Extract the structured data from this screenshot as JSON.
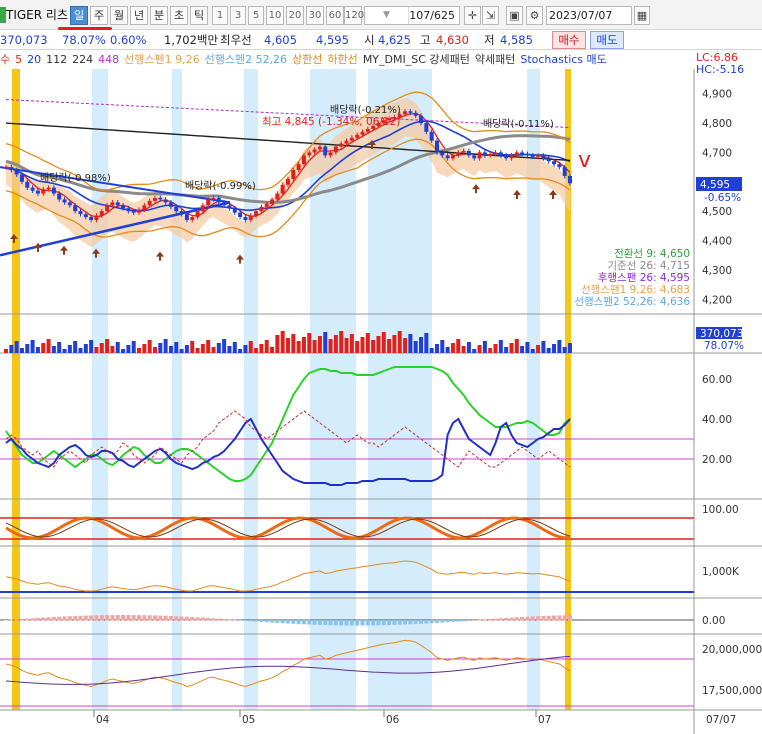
{
  "toolbar": {
    "ticker": "TIGER 리츠",
    "periods": [
      "일",
      "주",
      "월",
      "년",
      "분",
      "초",
      "틱"
    ],
    "active_period": "일",
    "intervals": [
      "1",
      "3",
      "5",
      "10",
      "20",
      "30",
      "60",
      "120"
    ],
    "count": "107/625",
    "date": "2023/07/07"
  },
  "quote": {
    "volume_lead": "370,073",
    "volume_ratio": "78.07%",
    "change_rate": "0.60%",
    "trade_value": "1,702백만",
    "best_label": "최우선",
    "best_ask": "4,605",
    "best_bid": "4,595",
    "open_label": "시",
    "open": "4,625",
    "high_label": "고",
    "high": "4,630",
    "low_label": "저",
    "low": "4,585",
    "buy_label": "매수",
    "sell_label": "매도"
  },
  "legend": {
    "items": [
      {
        "text": "수",
        "color": "#e0211b"
      },
      {
        "text": "5",
        "color": "#e0211b"
      },
      {
        "text": "20",
        "color": "#1f3fd6"
      },
      {
        "text": "112",
        "color": "#333333"
      },
      {
        "text": "224",
        "color": "#333333"
      },
      {
        "text": "448",
        "color": "#b030c0"
      },
      {
        "text": "선행스펜1 9,26",
        "color": "#e5a24a"
      },
      {
        "text": "선행스펜2 52,26",
        "color": "#5aa7e6"
      },
      {
        "text": "상한선",
        "color": "#e58a1a"
      },
      {
        "text": "하한선",
        "color": "#e58a1a"
      },
      {
        "text": "MY_DMI_SC 강세패턴",
        "color": "#333333"
      },
      {
        "text": "약세패턴",
        "color": "#333333"
      },
      {
        "text": "Stochastics 매도",
        "color": "#1f3fd6"
      }
    ],
    "lc": "LC:6.86",
    "hc": "HC:-5.16"
  },
  "price_axis": {
    "ticks": [
      "4,900",
      "4,800",
      "4,700",
      "4,600",
      "4,500",
      "4,400",
      "4,300",
      "4,200"
    ],
    "last_price": "4,595",
    "last_change": "-0.65%"
  },
  "ichimoku_info": [
    {
      "text": "전환선 9: 4,650",
      "color": "#2e9e3e"
    },
    {
      "text": "기준선 26: 4,715",
      "color": "#888888"
    },
    {
      "text": "후행스팬 26: 4,595",
      "color": "#8a2be2"
    },
    {
      "text": "선행스팬1 9,26: 4,683",
      "color": "#e5a24a"
    },
    {
      "text": "선행스팬2 52,26: 4,636",
      "color": "#5aa7e6"
    }
  ],
  "annotations": {
    "high_note": "최고 4,845 (-1.34%, 06/12)",
    "dividend_1": "배당락(-0.98%)",
    "dividend_2": "배당락(-0.99%)",
    "dividend_3": "배당락(-0.21%)",
    "dividend_4": "배당락(-0.11%)",
    "check_mark": "v"
  },
  "volume_axis": {
    "volume": "370,073",
    "ratio": "78.07%"
  },
  "indicator_axes": {
    "dmi": [
      "60.00",
      "40.00",
      "20.00"
    ],
    "stoch": [
      "100.00"
    ],
    "obv": [
      "1,000K"
    ],
    "macd_osc": [
      "0.00"
    ],
    "money": [
      "20,000,000",
      "17,500,000"
    ]
  },
  "x_axis": {
    "months": [
      "04",
      "05",
      "06",
      "07"
    ],
    "current_date": "07/07"
  },
  "colors": {
    "up": "#e0211b",
    "down": "#1f3fd6",
    "highlight": "#f5c518",
    "band": "#cde9fb",
    "cloud_up": "#f6c9a0",
    "cloud_down": "#a9d3f5"
  },
  "chart_data": {
    "type": "candlestick",
    "price_range": [
      4150,
      4950
    ],
    "close": [
      4650,
      4640,
      4625,
      4600,
      4580,
      4570,
      4560,
      4575,
      4580,
      4560,
      4540,
      4530,
      4520,
      4500,
      4490,
      4480,
      4470,
      4485,
      4500,
      4520,
      4530,
      4520,
      4510,
      4500,
      4495,
      4505,
      4520,
      4535,
      4545,
      4540,
      4530,
      4515,
      4500,
      4490,
      4470,
      4480,
      4500,
      4520,
      4540,
      4545,
      4530,
      4520,
      4510,
      4495,
      4480,
      4470,
      4485,
      4500,
      4515,
      4525,
      4540,
      4560,
      4590,
      4610,
      4640,
      4660,
      4690,
      4700,
      4710,
      4720,
      4690,
      4700,
      4720,
      4730,
      4740,
      4750,
      4760,
      4770,
      4780,
      4790,
      4800,
      4810,
      4815,
      4820,
      4830,
      4840,
      4835,
      4825,
      4800,
      4770,
      4740,
      4700,
      4690,
      4680,
      4690,
      4700,
      4705,
      4690,
      4680,
      4700,
      4690,
      4695,
      4700,
      4690,
      4680,
      4690,
      4700,
      4695,
      4690,
      4685,
      4690,
      4680,
      4670,
      4660,
      4650,
      4620,
      4595
    ],
    "volume_max": 1000000,
    "dmi_range": [
      0,
      70
    ],
    "dmi_levels": [
      20,
      30
    ],
    "stoch_levels": [
      20,
      80
    ],
    "dmi_plus": [
      28,
      30,
      27,
      25,
      22,
      20,
      18,
      17,
      16,
      18,
      22,
      24,
      26,
      27,
      25,
      22,
      21,
      22,
      24,
      24,
      23,
      20,
      19,
      17,
      16,
      18,
      20,
      22,
      24,
      25,
      23,
      20,
      18,
      17,
      16,
      15,
      16,
      18,
      19,
      21,
      22,
      24,
      27,
      30,
      34,
      38,
      40,
      35,
      30,
      26,
      22,
      18,
      14,
      12,
      10,
      9,
      8,
      8,
      8,
      8,
      8,
      7,
      7,
      7,
      8,
      8,
      8,
      9,
      9,
      9,
      10,
      10,
      10,
      10,
      10,
      10,
      9,
      9,
      9,
      9,
      9,
      10,
      12,
      32,
      38,
      40,
      35,
      30,
      28,
      26,
      24,
      22,
      28,
      36,
      38,
      32,
      28,
      27,
      26,
      28,
      30,
      31,
      33,
      35,
      35,
      37,
      40
    ],
    "dmi_minus": [
      34,
      30,
      26,
      22,
      20,
      18,
      18,
      20,
      22,
      24,
      22,
      20,
      18,
      16,
      18,
      20,
      22,
      22,
      20,
      18,
      17,
      19,
      22,
      24,
      26,
      25,
      22,
      20,
      18,
      18,
      20,
      22,
      24,
      25,
      25,
      24,
      22,
      20,
      18,
      16,
      14,
      12,
      10,
      9,
      9,
      10,
      12,
      16,
      20,
      24,
      28,
      34,
      40,
      46,
      52,
      56,
      60,
      63,
      64,
      65,
      65,
      64,
      64,
      63,
      63,
      63,
      62,
      62,
      62,
      62,
      63,
      64,
      65,
      66,
      66,
      66,
      66,
      66,
      66,
      66,
      66,
      65,
      64,
      62,
      58,
      55,
      52,
      48,
      45,
      42,
      40,
      38,
      36,
      36,
      36,
      37,
      38,
      38,
      39,
      38,
      36,
      34,
      32,
      32,
      33,
      38,
      40
    ],
    "adx": [
      30,
      32,
      30,
      26,
      24,
      22,
      24,
      20,
      18,
      16,
      20,
      22,
      24,
      22,
      20,
      18,
      22,
      24,
      26,
      24,
      22,
      24,
      28,
      26,
      22,
      20,
      18,
      20,
      22,
      26,
      24,
      22,
      20,
      18,
      22,
      24,
      26,
      30,
      32,
      34,
      38,
      40,
      42,
      44,
      42,
      40,
      36,
      34,
      32,
      30,
      32,
      34,
      36,
      38,
      40,
      42,
      44,
      42,
      40,
      38,
      36,
      34,
      32,
      30,
      28,
      30,
      32,
      30,
      28,
      28,
      26,
      28,
      30,
      32,
      34,
      36,
      34,
      32,
      30,
      28,
      26,
      24,
      22,
      20,
      18,
      16,
      20,
      24,
      22,
      20,
      18,
      16,
      16,
      18,
      20,
      22,
      24,
      26,
      24,
      22,
      20,
      22,
      24,
      22,
      20,
      18,
      16
    ]
  }
}
